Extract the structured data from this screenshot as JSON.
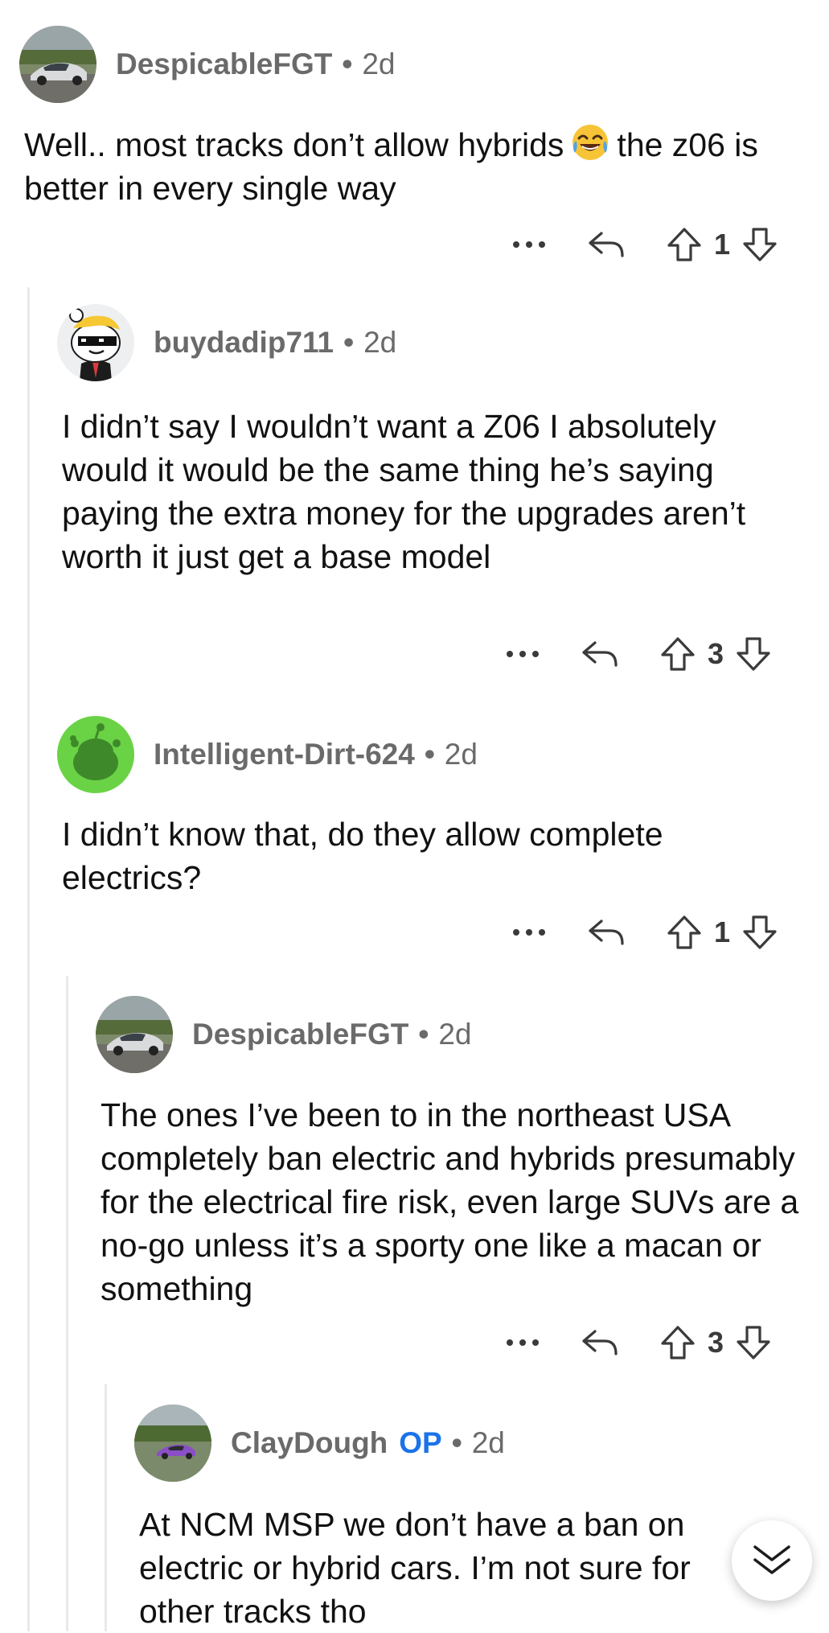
{
  "comments": [
    {
      "author": "DespicableFGT",
      "op_badge": "",
      "separator": "•",
      "age": "2d",
      "avatar": "silver-corvette-avatar",
      "text_parts": [
        "Well.. most tracks don’t allow hybrids",
        "the z06 is better in every single way"
      ],
      "emoji": "face-with-tears-of-joy",
      "votes": "1"
    },
    {
      "author": "buydadip711",
      "op_badge": "",
      "separator": "•",
      "age": "2d",
      "avatar": "snoo-sunglasses-avatar",
      "text": "I didn’t say I wouldn’t want a Z06 I absolutely would it would be the same thing he’s saying paying the extra money for the upgrades aren’t worth it just get a base model",
      "votes": "3"
    },
    {
      "author": "Intelligent-Dirt-624",
      "op_badge": "",
      "separator": "•",
      "age": "2d",
      "avatar": "green-snoo-avatar",
      "text": "I didn’t know that, do they allow complete electrics?",
      "votes": "1"
    },
    {
      "author": "DespicableFGT",
      "op_badge": "",
      "separator": "•",
      "age": "2d",
      "avatar": "silver-corvette-avatar",
      "text": "The ones I’ve been to in the northeast USA completely ban electric and hybrids presumably for the electrical fire risk, even large SUVs are a no-go unless it’s a sporty one like a macan or something",
      "votes": "3"
    },
    {
      "author": "ClayDough",
      "op_badge": "OP",
      "separator": "•",
      "age": "2d",
      "avatar": "purple-car-avatar",
      "text": "At NCM MSP we don’t have a ban on electric or hybrid cars. I’m not sure for other tracks tho",
      "votes": ""
    }
  ],
  "actions": {
    "more_icon": "more-dots-icon",
    "reply_icon": "reply-arrow-icon",
    "upvote_icon": "upvote-arrow-icon",
    "downvote_icon": "downvote-arrow-icon"
  },
  "fab": {
    "icon": "double-chevron-down-icon"
  },
  "colors": {
    "meta_text": "#6a6a6a",
    "body_text": "#111111",
    "op_badge": "#1a73e8",
    "thread_line": "#e9e9e9",
    "green_avatar": "#6ad345"
  }
}
